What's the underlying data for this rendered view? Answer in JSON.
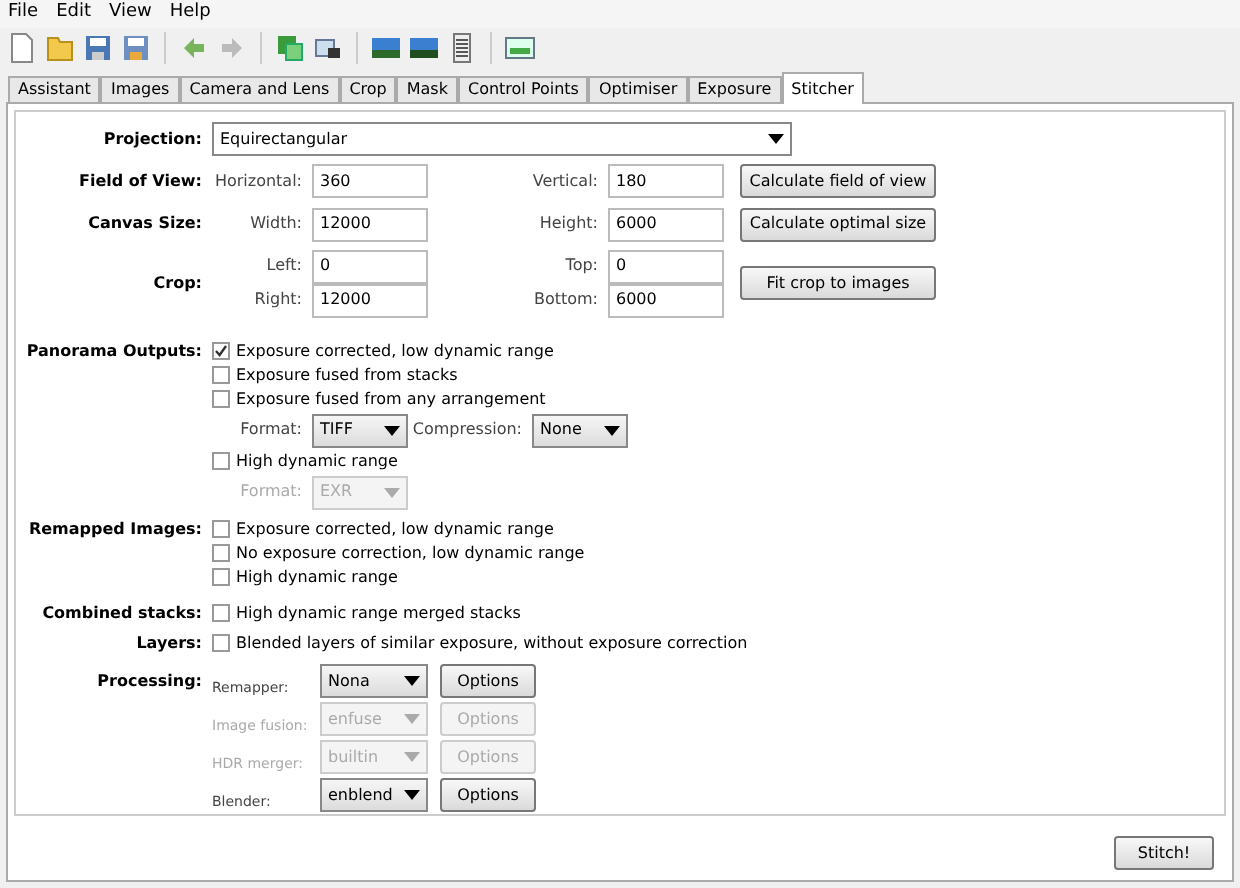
{
  "menu": [
    "File",
    "Edit",
    "View",
    "Help"
  ],
  "tabs": [
    {
      "label": "Assistant",
      "selected": false
    },
    {
      "label": "Images",
      "selected": false
    },
    {
      "label": "Camera and Lens",
      "selected": false
    },
    {
      "label": "Crop",
      "selected": false
    },
    {
      "label": "Mask",
      "selected": false
    },
    {
      "label": "Control Points",
      "selected": false
    },
    {
      "label": "Optimiser",
      "selected": false
    },
    {
      "label": "Exposure",
      "selected": false
    },
    {
      "label": "Stitcher",
      "selected": true
    }
  ],
  "projection": {
    "label": "Projection:",
    "value": "Equirectangular"
  },
  "field_of_view": {
    "label": "Field of View:",
    "fields": [
      {
        "label": "Horizontal:",
        "value": "360"
      },
      {
        "label": "Vertical:",
        "value": "180"
      }
    ],
    "button": "Calculate field of view"
  },
  "canvas_size": {
    "label": "Canvas Size:",
    "fields": [
      {
        "label": "Width:",
        "value": "12000"
      },
      {
        "label": "Height:",
        "value": "6000"
      }
    ],
    "button": "Calculate optimal size"
  },
  "crop": {
    "label": "Crop:",
    "fields": [
      {
        "label": "Left:",
        "value": "0"
      },
      {
        "label": "Top:",
        "value": "0"
      },
      {
        "label": "Right:",
        "value": "12000"
      },
      {
        "label": "Bottom:",
        "value": "6000"
      }
    ],
    "button": "Fit crop to images"
  },
  "panorama_outputs": {
    "label": "Panorama Outputs:",
    "options": [
      {
        "label": "Exposure corrected, low dynamic range",
        "checked": true
      },
      {
        "label": "Exposure fused from stacks",
        "checked": false
      },
      {
        "label": "Exposure fused from any arrangement",
        "checked": false
      }
    ],
    "ldr_format": {
      "label": "Format:",
      "value": "TIFF",
      "disabled": false
    },
    "compression": {
      "label": "Compression:",
      "value": "None"
    },
    "hdr": {
      "label": "High dynamic range",
      "checked": false
    },
    "hdr_format": {
      "label": "Format:",
      "value": "EXR",
      "disabled": true
    }
  },
  "remapped_images": {
    "label": "Remapped Images:",
    "options": [
      {
        "label": "Exposure corrected, low dynamic range",
        "checked": false
      },
      {
        "label": "No exposure correction, low dynamic range",
        "checked": false
      },
      {
        "label": "High dynamic range",
        "checked": false
      }
    ]
  },
  "combined_stacks": {
    "label": "Combined stacks:",
    "options": [
      {
        "label": "High dynamic range merged stacks",
        "checked": false
      }
    ]
  },
  "layers": {
    "label": "Layers:",
    "options": [
      {
        "label": "Blended layers of similar exposure, without exposure correction",
        "checked": false
      }
    ]
  },
  "processing": {
    "label": "Processing:",
    "rows": [
      {
        "label": "Remapper:",
        "value": "Nona",
        "button": "Options",
        "disabled": false
      },
      {
        "label": "Image fusion:",
        "value": "enfuse",
        "button": "Options",
        "disabled": true
      },
      {
        "label": "HDR merger:",
        "value": "builtin",
        "button": "Options",
        "disabled": true
      },
      {
        "label": "Blender:",
        "value": "enblend",
        "button": "Options",
        "disabled": false
      }
    ]
  },
  "stitch_button": "Stitch!"
}
